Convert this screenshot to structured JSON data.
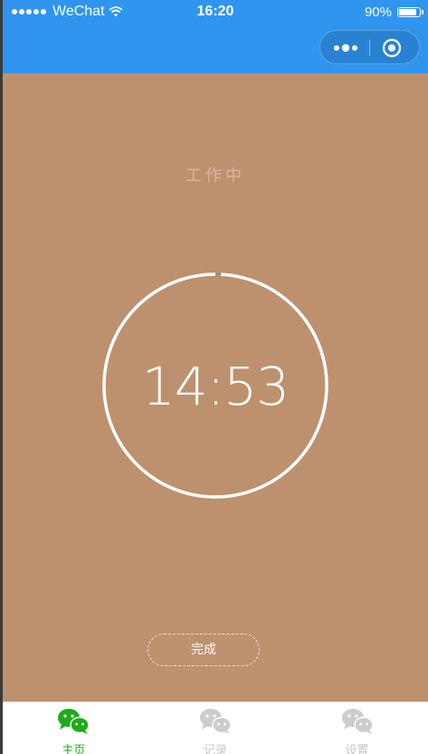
{
  "status_bar": {
    "carrier": "WeChat",
    "time": "16:20",
    "battery_text": "90%",
    "battery_level": 0.9
  },
  "capsule": {
    "more_icon": "more-dots-icon",
    "close_icon": "target-circle-icon"
  },
  "timer": {
    "status_label": "工作中",
    "remaining": "14:53",
    "progress_elapsed": 0.008
  },
  "actions": {
    "done_label": "完成"
  },
  "tabbar": {
    "items": [
      {
        "label": "主页",
        "icon": "wechat-chat-icon",
        "active": true
      },
      {
        "label": "记录",
        "icon": "wechat-chat-icon",
        "active": false
      },
      {
        "label": "设置",
        "icon": "wechat-chat-icon",
        "active": false
      }
    ]
  },
  "colors": {
    "navbar": "#2f95ee",
    "background": "#bd916e",
    "status_label": "#d8b89d",
    "tab_active": "#1aad19",
    "tab_inactive": "#cccccc",
    "ring_elapsed": "#8a8a8a"
  }
}
